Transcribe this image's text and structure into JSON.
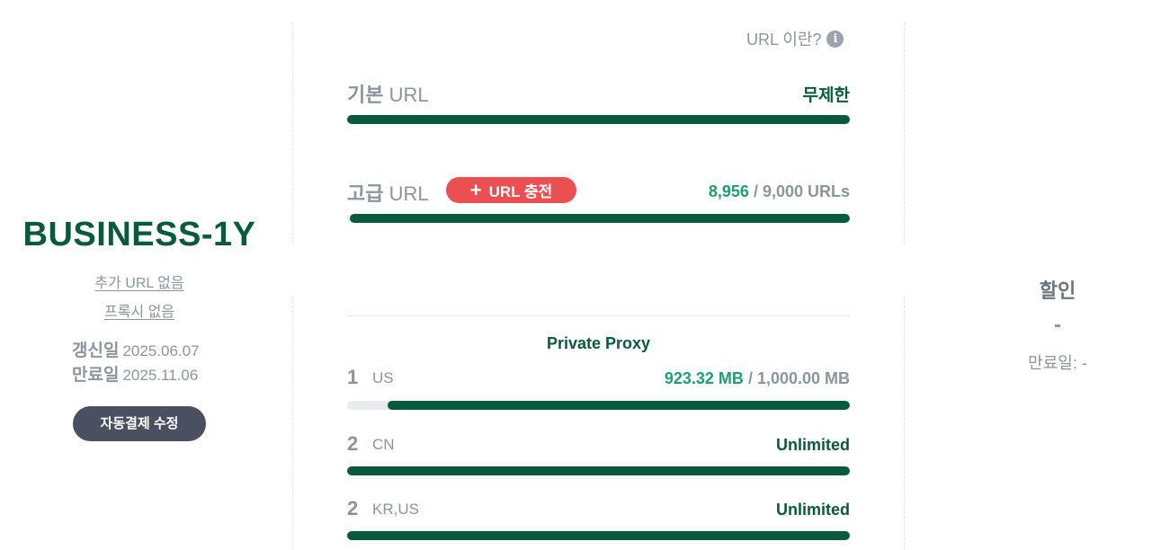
{
  "plan": {
    "name": "BUSINESS-1Y",
    "extra_url": "추가 URL 없음",
    "proxy": "프록시 없음",
    "renew_label": "갱신일",
    "renew_date": "2025.06.07",
    "expire_label": "만료일",
    "expire_date": "2025.11.06",
    "autopay_button": "자동결제 수정"
  },
  "url_section": {
    "help_text": "URL 이란?",
    "help_icon": "info-icon",
    "basic": {
      "label_ko": "기본",
      "label_en": "URL",
      "value": "무제한",
      "progress": 1.0
    },
    "premium": {
      "label_ko": "고급",
      "label_en": "URL",
      "charge_button": "URL 충전",
      "charge_icon": "plus-icon",
      "used": "8,956",
      "total": "/ 9,000 URLs",
      "progress": 0.995
    }
  },
  "proxy_section": {
    "title": "Private Proxy",
    "items": [
      {
        "num": "1",
        "region": "US",
        "used": "923.32 MB",
        "total": "/ 1,000.00 MB",
        "unlimited": "",
        "progress": 0.92
      },
      {
        "num": "2",
        "region": "CN",
        "used": "",
        "total": "",
        "unlimited": "Unlimited",
        "progress": 1.0
      },
      {
        "num": "2",
        "region": "KR,US",
        "used": "",
        "total": "",
        "unlimited": "Unlimited",
        "progress": 1.0
      }
    ]
  },
  "discount": {
    "title": "할인",
    "value": "-",
    "expire_label": "만료일",
    "expire_value": ": -"
  },
  "colors": {
    "brand_green": "#075a3c",
    "used_green": "#1f9e72",
    "charge_red": "#eb4f52",
    "autopay_bg": "#4a5060",
    "muted_text": "#8a959e"
  }
}
